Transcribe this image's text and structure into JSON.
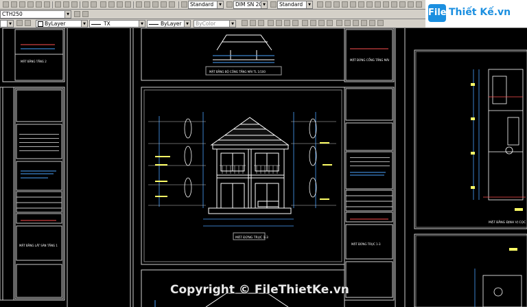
{
  "toolbar": {
    "text_style": "Standard",
    "dim_style": "DIM SN 20",
    "table_style": "Standard",
    "layer_name": "CTH250",
    "color_control": "ByLayer",
    "linetype_control": "TX",
    "lineweight_control": "ByLayer",
    "plotstyle_control": "ByColor"
  },
  "logo": {
    "badge": "File",
    "text": "Thiết Kế.vn"
  },
  "drawing": {
    "label_floor2": "MẶT BẰNG TẦNG 2",
    "label_gate_top": "MẶT BẰNG BỘ CÔNG TẦNG MÁI TL 1/100",
    "label_gate_right": "MẶT ĐỨNG CỔNG TẦNG MÁI",
    "label_elevation": "MẶT ĐỨNG TRỤC 1-3",
    "label_elevation_right": "MẶT ĐỨNG TRỤC 1-3",
    "label_roof_left": "MẶT BẰNG LÁT SÀN TẦNG 1",
    "label_plan_right": "MẶT BẰNG ĐỊNH VỊ CỌC"
  },
  "watermark": "Copyright © FileThietKe.vn"
}
